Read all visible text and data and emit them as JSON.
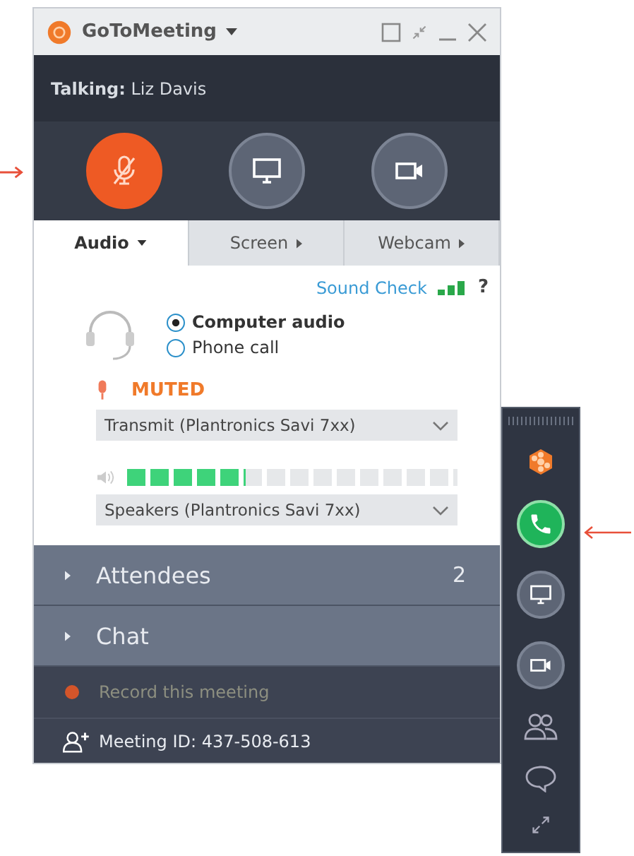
{
  "window": {
    "title": "GoToMeeting"
  },
  "talking": "**Talking:** Liz Davis",
  "controls": [
    {
      "kind": "mic",
      "active": true
    },
    {
      "kind": "screen",
      "active": false
    },
    {
      "kind": "webcam",
      "active": false
    }
  ],
  "tabs": [
    {
      "label": "Audio",
      "selected": true
    },
    {
      "label": "Screen",
      "selected": false
    },
    {
      "label": "Webcam",
      "selected": false
    }
  ],
  "audio": {
    "sound_check": "Sound Check",
    "help": "?",
    "options": [
      {
        "label": "Computer audio",
        "selected": true
      },
      {
        "label": "Phone call",
        "selected": false
      }
    ],
    "mute_status": "MUTED",
    "transmit": "Transmit (Plantronics Savi 7xx)",
    "speaker_meter": {
      "level": 0.357
    },
    "speakers": "Speakers (Plantronics Savi 7xx)"
  },
  "panels": [
    {
      "label": "Attendees",
      "count": "2"
    },
    {
      "label": "Chat"
    }
  ],
  "record": "Record this meeting",
  "meeting_id": "Meeting ID: 437-508-613",
  "mini_bar": [
    {
      "kind": "logo"
    },
    {
      "kind": "phone"
    },
    {
      "kind": "screen"
    },
    {
      "kind": "webcam"
    },
    {
      "kind": "people"
    },
    {
      "kind": "chat"
    },
    {
      "kind": "expand"
    }
  ]
}
